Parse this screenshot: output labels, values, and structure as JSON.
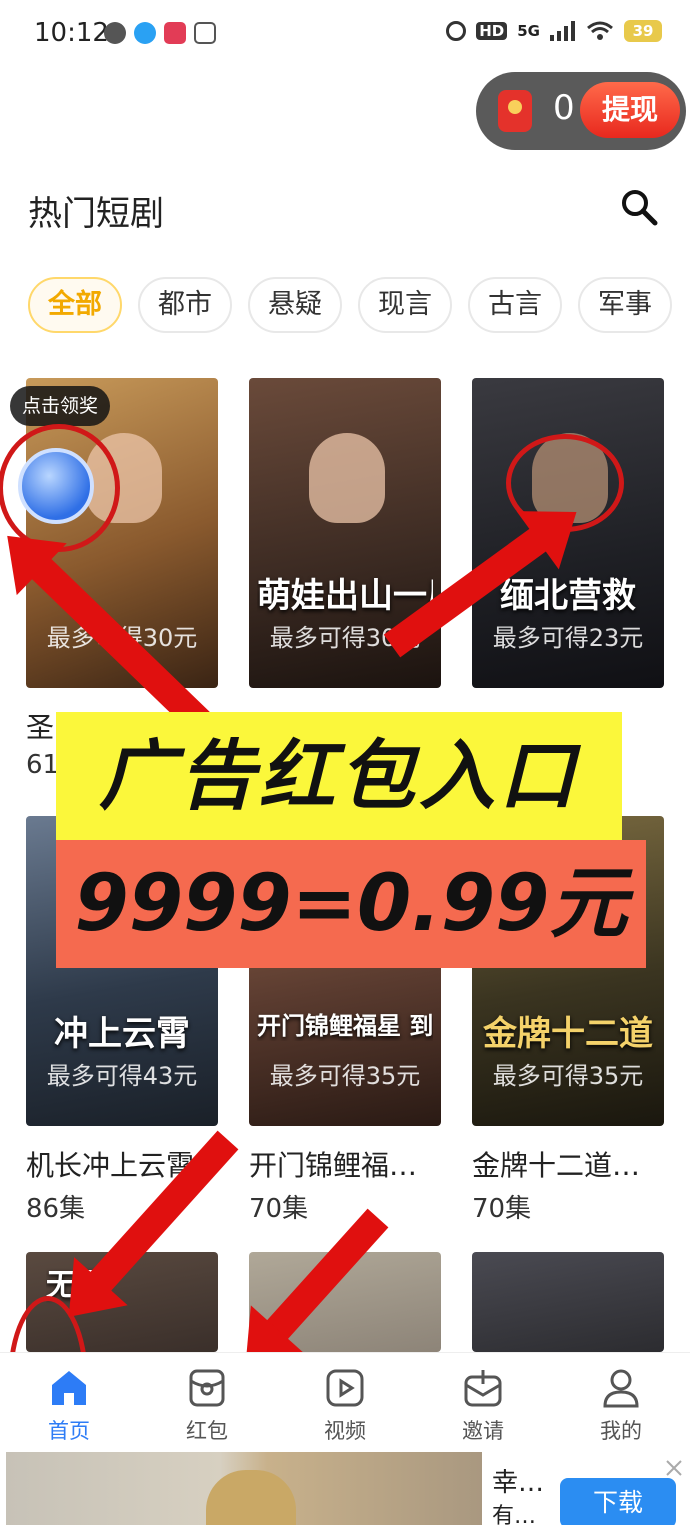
{
  "status_bar": {
    "time": "10:12",
    "battery": "39",
    "network": "5G",
    "hd": "HD"
  },
  "wallet": {
    "balance": "0",
    "withdraw_label": "提现"
  },
  "header": {
    "title": "热门短剧"
  },
  "categories": [
    "全部",
    "都市",
    "悬疑",
    "现言",
    "古言",
    "军事"
  ],
  "reward_tip": "点击领奖",
  "dramas": [
    {
      "name": "圣",
      "episodes": "61",
      "poster_label": "最多可得30元",
      "poster_title": "",
      "color": "#8a5a2e"
    },
    {
      "name": "",
      "episodes": "",
      "poster_label": "最多可得30元",
      "poster_title": "萌娃出山一局定",
      "color": "#3b2a22"
    },
    {
      "name": "",
      "episodes": "",
      "poster_label": "最多可得23元",
      "poster_title": "缅北营救",
      "color": "#1e1f24"
    },
    {
      "name": "机长冲上云霄",
      "episodes": "86集",
      "poster_label": "最多可得43元",
      "poster_title": "冲上云霄",
      "color": "#2e3a4a"
    },
    {
      "name": "开门锦鲤福…",
      "episodes": "70集",
      "poster_label": "最多可得35元",
      "poster_title": "开门锦鲤福星 到家了",
      "color": "#5a3b2f"
    },
    {
      "name": "金牌十二道…",
      "episodes": "70集",
      "poster_label": "最多可得35元",
      "poster_title": "金牌十二道",
      "color": "#3a3420"
    },
    {
      "name": "",
      "episodes": "",
      "poster_label": "",
      "poster_title": "无罪",
      "color": "#3a2f2a"
    },
    {
      "name": "",
      "episodes": "",
      "poster_label": "",
      "poster_title": "",
      "color": "#8d8478"
    },
    {
      "name": "",
      "episodes": "",
      "poster_label": "",
      "poster_title": "",
      "color": "#2c2c30"
    }
  ],
  "overlay": {
    "line1": "广告红包入口",
    "line2": "9999=0.99元"
  },
  "tab_bar": [
    {
      "label": "首页",
      "icon": "home-icon"
    },
    {
      "label": "红包",
      "icon": "red-packet-icon"
    },
    {
      "label": "视频",
      "icon": "video-icon"
    },
    {
      "label": "邀请",
      "icon": "invite-icon"
    },
    {
      "label": "我的",
      "icon": "profile-icon"
    }
  ],
  "ad": {
    "title": "幸…",
    "subtitle": "有…",
    "download_label": "下载"
  },
  "colors": {
    "accent": "#2d7cf6",
    "annotation": "#e0100f",
    "highlight_yellow": "#fbf73b",
    "highlight_orange": "#f56a4f"
  }
}
